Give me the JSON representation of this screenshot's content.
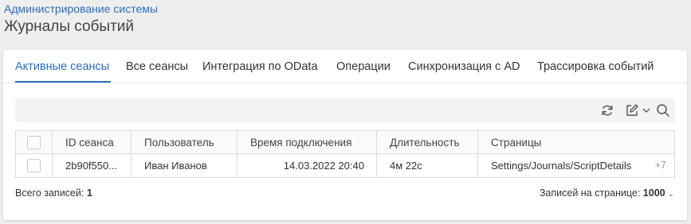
{
  "breadcrumb": "Администрирование системы",
  "title": "Журналы событий",
  "tabs": [
    {
      "label": "Активные сеансы",
      "active": true
    },
    {
      "label": "Все сеансы"
    },
    {
      "label": "Интеграция по OData"
    },
    {
      "label": "Операции"
    },
    {
      "label": "Синхронизация с AD"
    },
    {
      "label": "Трассировка событий"
    }
  ],
  "toolbar": {
    "icons": [
      "refresh-icon",
      "edit-icon",
      "chevron-down-icon",
      "search-icon"
    ]
  },
  "grid": {
    "columns": [
      "ID сеанса",
      "Пользователь",
      "Время подключения",
      "Длительность",
      "Страницы"
    ],
    "rows": [
      {
        "session_id": "2b90f550...",
        "user": "Иван Иванов",
        "connected_at": "14.03.2022 20:40",
        "duration": "4м 22с",
        "pages": "Settings/Journals/ScriptDetails",
        "more": "+7"
      }
    ]
  },
  "footer": {
    "total_label": "Всего записей:",
    "total_value": "1",
    "page_size_label": "Записей на странице:",
    "page_size_value": "1000"
  },
  "colors": {
    "accent": "#2a6ebb",
    "background": "#eeeeee",
    "card": "#ffffff"
  }
}
